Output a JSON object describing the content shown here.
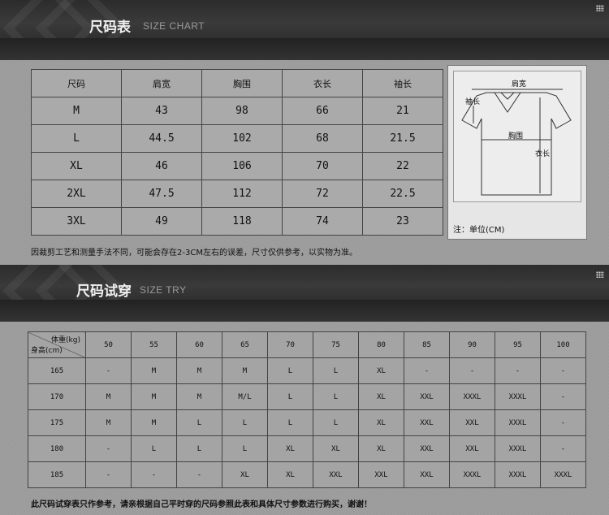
{
  "section1": {
    "title": "尺码表",
    "subtitle": "SIZE CHART"
  },
  "size_table": {
    "headers": [
      "尺码",
      "肩宽",
      "胸围",
      "衣长",
      "袖长"
    ],
    "rows": [
      [
        "M",
        "43",
        "98",
        "66",
        "21"
      ],
      [
        "L",
        "44.5",
        "102",
        "68",
        "21.5"
      ],
      [
        "XL",
        "46",
        "106",
        "70",
        "22"
      ],
      [
        "2XL",
        "47.5",
        "112",
        "72",
        "22.5"
      ],
      [
        "3XL",
        "49",
        "118",
        "74",
        "23"
      ]
    ]
  },
  "diagram": {
    "shoulder": "肩宽",
    "sleeve": "袖长",
    "chest": "胸围",
    "length": "衣长",
    "unit_note": "注：单位(CM)"
  },
  "note1": "因裁剪工艺和测量手法不同，可能会存在2-3CM左右的误差，尺寸仅供参考，以实物为准。",
  "section2": {
    "title": "尺码试穿",
    "subtitle": "SIZE TRY"
  },
  "try_table": {
    "weight_label": "体重(kg)",
    "height_label": "身高(cm)",
    "weights": [
      "50",
      "55",
      "60",
      "65",
      "70",
      "75",
      "80",
      "85",
      "90",
      "95",
      "100"
    ],
    "rows": [
      {
        "height": "165",
        "cells": [
          "-",
          "M",
          "M",
          "M",
          "L",
          "L",
          "XL",
          "-",
          "-",
          "-",
          "-"
        ]
      },
      {
        "height": "170",
        "cells": [
          "M",
          "M",
          "M",
          "M/L",
          "L",
          "L",
          "XL",
          "XXL",
          "XXXL",
          "XXXL",
          "-"
        ]
      },
      {
        "height": "175",
        "cells": [
          "M",
          "M",
          "L",
          "L",
          "L",
          "L",
          "XL",
          "XXL",
          "XXL",
          "XXXL",
          "-"
        ]
      },
      {
        "height": "180",
        "cells": [
          "-",
          "L",
          "L",
          "L",
          "XL",
          "XL",
          "XL",
          "XXL",
          "XXL",
          "XXXL",
          "-"
        ]
      },
      {
        "height": "185",
        "cells": [
          "-",
          "-",
          "-",
          "XL",
          "XL",
          "XXL",
          "XXL",
          "XXL",
          "XXXL",
          "XXXL",
          "XXXL"
        ]
      }
    ]
  },
  "note2": "此尺码试穿表只作参考，请亲根据自己平时穿的尺码参照此表和具体尺寸参数进行购买，谢谢！"
}
